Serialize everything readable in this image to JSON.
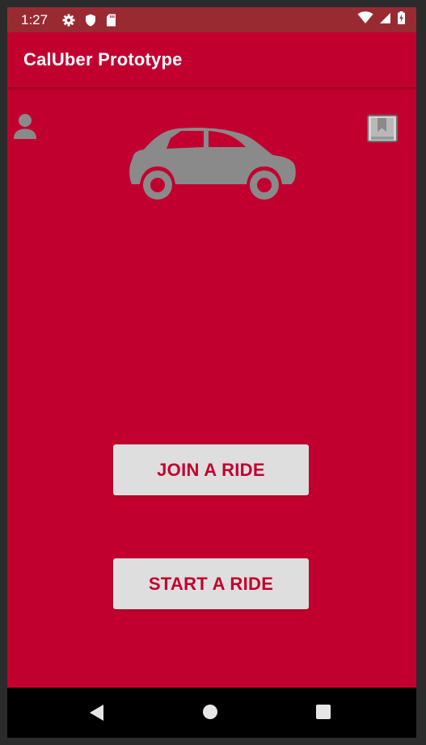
{
  "status_bar": {
    "time": "1:27",
    "left_icons": [
      "gear-icon",
      "shield-icon",
      "sd-card-icon"
    ],
    "right_icons": [
      "wifi-icon",
      "signal-icon",
      "battery-icon"
    ]
  },
  "app_bar": {
    "title": "CalUber Prototype"
  },
  "colors": {
    "primary": "#c2002f",
    "status_bar": "#9a2a32",
    "button_bg": "#dedede",
    "icon_gray": "#8a8a8a"
  },
  "main": {
    "icons": [
      "profile-icon",
      "bookmark-icon",
      "car-icon"
    ],
    "join_button_label": "JOIN A RIDE",
    "start_button_label": "START A RIDE"
  },
  "nav_bar": {
    "buttons": [
      "back",
      "home",
      "recents"
    ]
  }
}
